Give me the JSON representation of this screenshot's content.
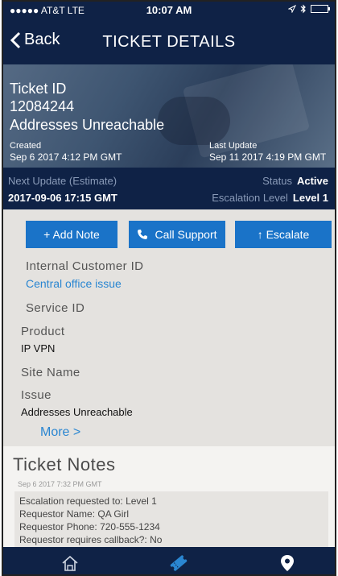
{
  "status_bar": {
    "carrier": "●●●●● AT&T  LTE",
    "time": "10:07 AM"
  },
  "nav": {
    "back_label": "Back",
    "title": "TICKET DETAILS"
  },
  "hero": {
    "ticket_id_label": "Ticket ID",
    "ticket_id": "12084244",
    "ticket_desc": "Addresses Unreachable",
    "created_label": "Created",
    "created_value": "Sep 6 2017 4:12 PM GMT",
    "last_update_label": "Last Update",
    "last_update_value": "Sep 11 2017 4:19 PM GMT"
  },
  "info": {
    "next_update_label": "Next Update (Estimate)",
    "next_update_value": "2017-09-06 17:15 GMT",
    "status_label": "Status",
    "status_value": "Active",
    "escalation_label": "Escalation Level",
    "escalation_value": "Level 1"
  },
  "actions": {
    "add_note": "+  Add Note",
    "call_support": "Call Support",
    "escalate": "↑  Escalate"
  },
  "fields": {
    "internal_customer_id_label": "Internal Customer ID",
    "internal_customer_id_value": "Central office issue",
    "service_id_label": "Service ID",
    "product_label": "Product",
    "product_value": "IP VPN",
    "site_name_label": "Site Name",
    "issue_label": "Issue",
    "issue_value": "Addresses Unreachable",
    "more_label": "More >"
  },
  "notes": {
    "title": "Ticket Notes",
    "date": "Sep 6 2017 7:32 PM GMT",
    "lines": [
      "Escalation requested to: Level 1",
      "Requestor Name: QA Girl",
      "Requestor Phone: 720-555-1234",
      "Requestor requires callback?: No"
    ]
  },
  "colors": {
    "navy": "#0f2246",
    "button_blue": "#1a73c8",
    "link_blue": "#2a86d1"
  },
  "tab_bar": {
    "icons": [
      "home-icon",
      "ticket-icon",
      "location-pin-icon"
    ],
    "active": "ticket-icon"
  }
}
